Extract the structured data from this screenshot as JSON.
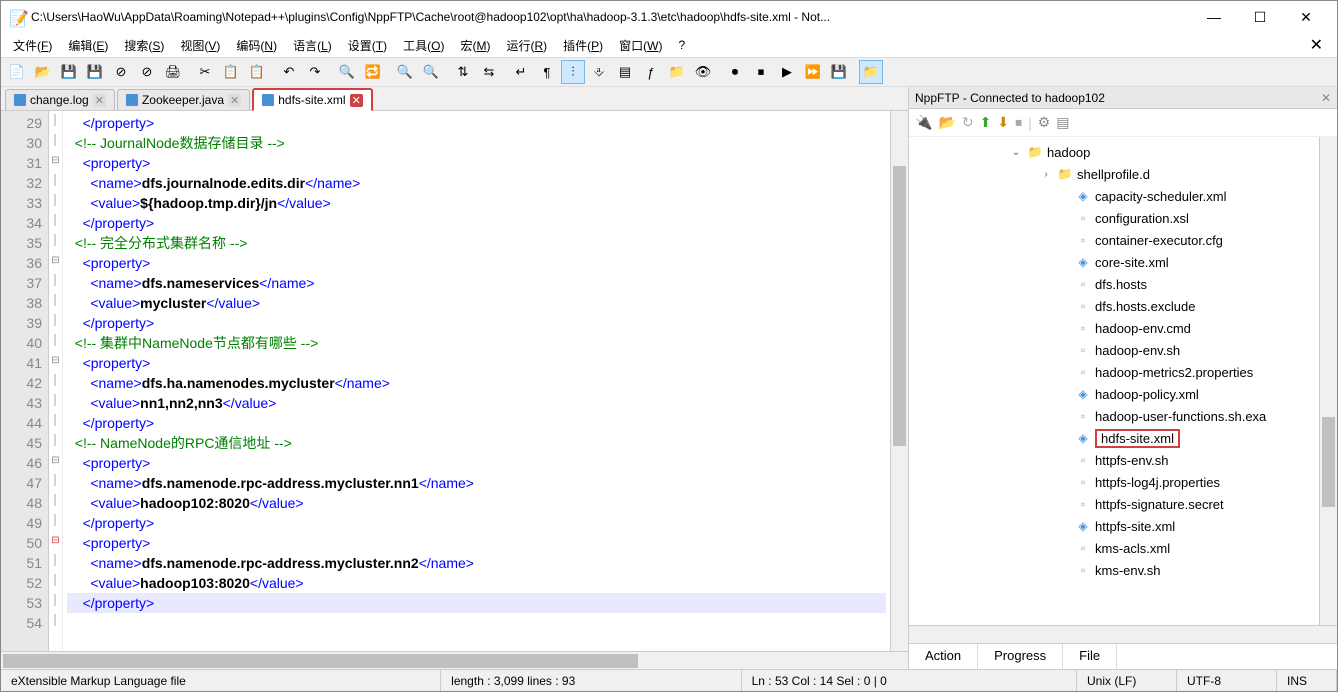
{
  "window": {
    "title": "C:\\Users\\HaoWu\\AppData\\Roaming\\Notepad++\\plugins\\Config\\NppFTP\\Cache\\root@hadoop102\\opt\\ha\\hadoop-3.1.3\\etc\\hadoop\\hdfs-site.xml - Not..."
  },
  "menus": [
    "文件(F)",
    "编辑(E)",
    "搜索(S)",
    "视图(V)",
    "编码(N)",
    "语言(L)",
    "设置(T)",
    "工具(O)",
    "宏(M)",
    "运行(R)",
    "插件(P)",
    "窗口(W)",
    "?"
  ],
  "tabs": [
    {
      "label": "change.log",
      "active": false
    },
    {
      "label": "Zookeeper.java",
      "active": false
    },
    {
      "label": "hdfs-site.xml",
      "active": true
    }
  ],
  "editor": {
    "first_line": 29,
    "highlighted_line": 53,
    "lines": [
      {
        "n": 29,
        "ind": 2,
        "tokens": [
          {
            "t": "tag",
            "v": "</property>"
          }
        ]
      },
      {
        "n": 30,
        "ind": 1,
        "tokens": [
          {
            "t": "com",
            "v": "<!-- JournalNode数据存储目录 -->"
          }
        ]
      },
      {
        "n": 31,
        "ind": 2,
        "fold": "-",
        "tokens": [
          {
            "t": "tag",
            "v": "<property>"
          }
        ]
      },
      {
        "n": 32,
        "ind": 3,
        "tokens": [
          {
            "t": "tag",
            "v": "<name>"
          },
          {
            "t": "val",
            "v": "dfs.journalnode.edits.dir"
          },
          {
            "t": "tag",
            "v": "</name>"
          }
        ]
      },
      {
        "n": 33,
        "ind": 3,
        "tokens": [
          {
            "t": "tag",
            "v": "<value>"
          },
          {
            "t": "val",
            "v": "${hadoop.tmp.dir}/jn"
          },
          {
            "t": "tag",
            "v": "</value>"
          }
        ]
      },
      {
        "n": 34,
        "ind": 2,
        "tokens": [
          {
            "t": "tag",
            "v": "</property>"
          }
        ]
      },
      {
        "n": 35,
        "ind": 1,
        "tokens": [
          {
            "t": "com",
            "v": "<!-- 完全分布式集群名称 -->"
          }
        ]
      },
      {
        "n": 36,
        "ind": 2,
        "fold": "-",
        "tokens": [
          {
            "t": "tag",
            "v": "<property>"
          }
        ]
      },
      {
        "n": 37,
        "ind": 3,
        "tokens": [
          {
            "t": "tag",
            "v": "<name>"
          },
          {
            "t": "val",
            "v": "dfs.nameservices"
          },
          {
            "t": "tag",
            "v": "</name>"
          }
        ]
      },
      {
        "n": 38,
        "ind": 3,
        "tokens": [
          {
            "t": "tag",
            "v": "<value>"
          },
          {
            "t": "val",
            "v": "mycluster"
          },
          {
            "t": "tag",
            "v": "</value>"
          }
        ]
      },
      {
        "n": 39,
        "ind": 2,
        "tokens": [
          {
            "t": "tag",
            "v": "</property>"
          }
        ]
      },
      {
        "n": 40,
        "ind": 1,
        "tokens": [
          {
            "t": "com",
            "v": "<!-- 集群中NameNode节点都有哪些 -->"
          }
        ]
      },
      {
        "n": 41,
        "ind": 2,
        "fold": "-",
        "tokens": [
          {
            "t": "tag",
            "v": "<property>"
          }
        ]
      },
      {
        "n": 42,
        "ind": 3,
        "tokens": [
          {
            "t": "tag",
            "v": "<name>"
          },
          {
            "t": "val",
            "v": "dfs.ha.namenodes.mycluster"
          },
          {
            "t": "tag",
            "v": "</name>"
          }
        ]
      },
      {
        "n": 43,
        "ind": 3,
        "tokens": [
          {
            "t": "tag",
            "v": "<value>"
          },
          {
            "t": "val",
            "v": "nn1,nn2,nn3"
          },
          {
            "t": "tag",
            "v": "</value>"
          }
        ]
      },
      {
        "n": 44,
        "ind": 2,
        "tokens": [
          {
            "t": "tag",
            "v": "</property>"
          }
        ]
      },
      {
        "n": 45,
        "ind": 1,
        "tokens": [
          {
            "t": "com",
            "v": "<!-- NameNode的RPC通信地址 -->"
          }
        ]
      },
      {
        "n": 46,
        "ind": 2,
        "fold": "-",
        "tokens": [
          {
            "t": "tag",
            "v": "<property>"
          }
        ]
      },
      {
        "n": 47,
        "ind": 3,
        "tokens": [
          {
            "t": "tag",
            "v": "<name>"
          },
          {
            "t": "val",
            "v": "dfs.namenode.rpc-address.mycluster.nn1"
          },
          {
            "t": "tag",
            "v": "</name>"
          }
        ]
      },
      {
        "n": 48,
        "ind": 3,
        "tokens": [
          {
            "t": "tag",
            "v": "<value>"
          },
          {
            "t": "val",
            "v": "hadoop102:8020"
          },
          {
            "t": "tag",
            "v": "</value>"
          }
        ]
      },
      {
        "n": 49,
        "ind": 2,
        "tokens": [
          {
            "t": "tag",
            "v": "</property>"
          }
        ]
      },
      {
        "n": 50,
        "ind": 2,
        "fold": "-",
        "foldcolor": "red",
        "tokens": [
          {
            "t": "tag",
            "v": "<property>"
          }
        ]
      },
      {
        "n": 51,
        "ind": 3,
        "tokens": [
          {
            "t": "tag",
            "v": "<name>"
          },
          {
            "t": "val",
            "v": "dfs.namenode.rpc-address.mycluster.nn2"
          },
          {
            "t": "tag",
            "v": "</name>"
          }
        ]
      },
      {
        "n": 52,
        "ind": 3,
        "tokens": [
          {
            "t": "tag",
            "v": "<value>"
          },
          {
            "t": "val",
            "v": "hadoop103:8020"
          },
          {
            "t": "tag",
            "v": "</value>"
          }
        ]
      },
      {
        "n": 53,
        "ind": 2,
        "hl": true,
        "tokens": [
          {
            "t": "tag",
            "v": "</property>"
          }
        ]
      },
      {
        "n": 54,
        "ind": 2,
        "tokens": []
      }
    ]
  },
  "ftp": {
    "title": "NppFTP - Connected to hadoop102",
    "toolbar_icons": [
      "connect",
      "open",
      "refresh",
      "upload",
      "download",
      "abort",
      "sep",
      "settings",
      "view"
    ],
    "tree": [
      {
        "depth": 0,
        "type": "folder",
        "name": "hadoop",
        "expanded": true,
        "exp": "v"
      },
      {
        "depth": 1,
        "type": "folder",
        "name": "shellprofile.d",
        "exp": ">"
      },
      {
        "depth": 2,
        "type": "xml",
        "name": "capacity-scheduler.xml"
      },
      {
        "depth": 2,
        "type": "file",
        "name": "configuration.xsl"
      },
      {
        "depth": 2,
        "type": "file",
        "name": "container-executor.cfg"
      },
      {
        "depth": 2,
        "type": "xml",
        "name": "core-site.xml"
      },
      {
        "depth": 2,
        "type": "file",
        "name": "dfs.hosts"
      },
      {
        "depth": 2,
        "type": "file",
        "name": "dfs.hosts.exclude"
      },
      {
        "depth": 2,
        "type": "file",
        "name": "hadoop-env.cmd"
      },
      {
        "depth": 2,
        "type": "file",
        "name": "hadoop-env.sh"
      },
      {
        "depth": 2,
        "type": "file",
        "name": "hadoop-metrics2.properties"
      },
      {
        "depth": 2,
        "type": "xml",
        "name": "hadoop-policy.xml"
      },
      {
        "depth": 2,
        "type": "file",
        "name": "hadoop-user-functions.sh.exa"
      },
      {
        "depth": 2,
        "type": "xml",
        "name": "hdfs-site.xml",
        "highlighted": true
      },
      {
        "depth": 2,
        "type": "file",
        "name": "httpfs-env.sh"
      },
      {
        "depth": 2,
        "type": "file",
        "name": "httpfs-log4j.properties"
      },
      {
        "depth": 2,
        "type": "file",
        "name": "httpfs-signature.secret"
      },
      {
        "depth": 2,
        "type": "xml",
        "name": "httpfs-site.xml"
      },
      {
        "depth": 2,
        "type": "file",
        "name": "kms-acls.xml"
      },
      {
        "depth": 2,
        "type": "file",
        "name": "kms-env.sh"
      }
    ],
    "tabs": [
      "Action",
      "Progress",
      "File"
    ]
  },
  "status": {
    "language": "eXtensible Markup Language file",
    "length": "length : 3,099    lines : 93",
    "pos": "Ln : 53    Col : 14    Sel : 0 | 0",
    "eol": "Unix (LF)",
    "enc": "UTF-8",
    "ins": "INS"
  }
}
